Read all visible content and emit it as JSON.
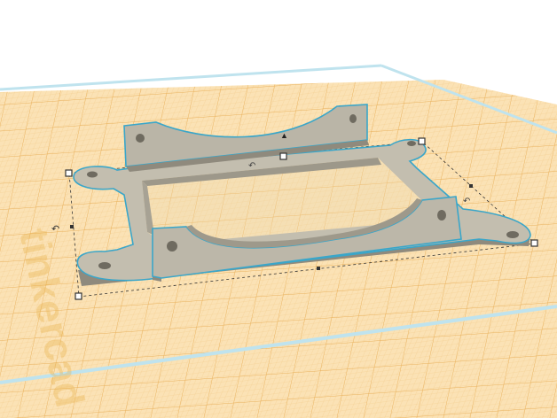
{
  "app": {
    "name": "Tinkercad 3D workplane"
  },
  "workplane": {
    "watermark": "tinkercad",
    "grid_color": "#f3c77a",
    "plane_color": "#fbe2b5",
    "edge_color": "#bfe3ee"
  },
  "model": {
    "name": "bracket",
    "body_color": "#b9b4a6",
    "top_color": "#c9c4b5",
    "side_color": "#8f8a7d",
    "selection_outline_color": "#3aa6c9"
  },
  "selection": {
    "rotation_arrow_glyph": "↶",
    "height_arrow_glyph": "▲"
  }
}
